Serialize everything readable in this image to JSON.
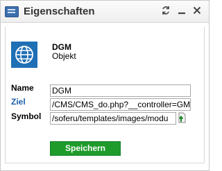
{
  "window": {
    "title": "Eigenschaften",
    "controls": [
      "refresh-icon",
      "minimize-icon",
      "close-icon"
    ]
  },
  "object": {
    "name": "DGM",
    "type": "Objekt",
    "icon": "globe-icon",
    "icon_color": "#1f6fb5"
  },
  "fields": {
    "name_label": "Name",
    "name_value": "DGM",
    "ziel_label": "Ziel",
    "ziel_value": "/CMS/CMS_do.php?__controller=GM",
    "symbol_label": "Symbol",
    "symbol_value": "/soferu/templates/images/modu"
  },
  "actions": {
    "save_label": "Speichern",
    "save_color": "#1e9b2b"
  },
  "colors": {
    "link": "#1a5fa8"
  }
}
